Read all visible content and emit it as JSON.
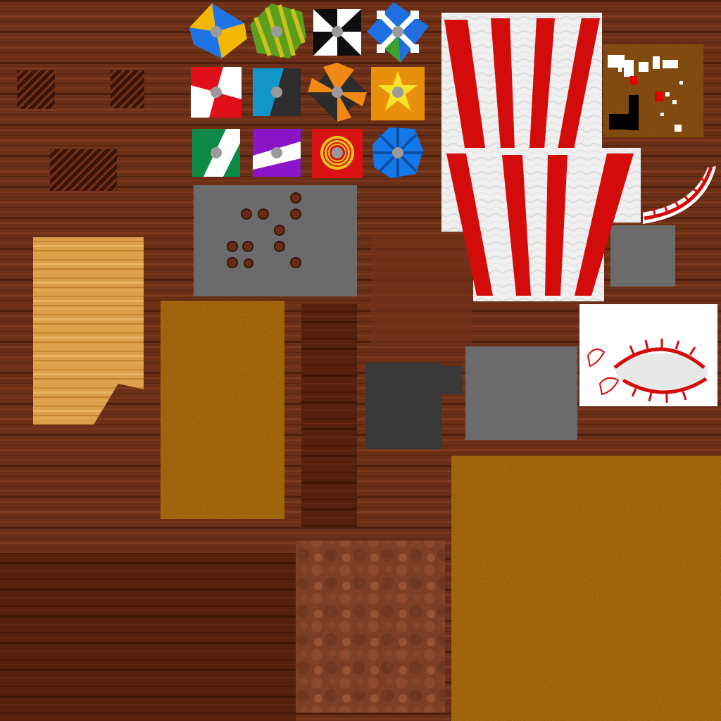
{
  "atlas": {
    "kind": "texture atlas",
    "background": "wood planks",
    "colors": {
      "wood_base": "#6b2e17",
      "wood_dark": "#4e1f0e",
      "wood_light": "#82391c",
      "light_wood": "#dca04a",
      "felt_orange": "#c07a0f",
      "felt_orange_dark": "#a66408",
      "gray": "#6b6b6b",
      "charcoal": "#383838",
      "popcorn_red": "#d30b0b",
      "popcorn_white": "#f2f2f2",
      "carpet_brown": "#7e3a22",
      "weave_dark": "#3b1409",
      "map_brown": "#9c5a12"
    }
  },
  "shields": [
    {
      "name": "yellow-blue-quartered-shield",
      "colors": [
        "#f2b705",
        "#1d74e5"
      ],
      "pattern": "quartered"
    },
    {
      "name": "green-yellow-striped-shield",
      "colors": [
        "#5c9d1f",
        "#c9c21a"
      ],
      "pattern": "striped"
    },
    {
      "name": "black-white-gyronny-shield",
      "colors": [
        "#0e0e0e",
        "#ffffff"
      ],
      "pattern": "gyronny"
    },
    {
      "name": "blue-green-cross-shield",
      "colors": [
        "#1f6fe0",
        "#3aa02e",
        "#ffffff"
      ],
      "pattern": "cross"
    },
    {
      "name": "red-white-quartered-shield",
      "colors": [
        "#e0101b",
        "#ffffff"
      ],
      "pattern": "quartered"
    },
    {
      "name": "blue-black-split-shield",
      "colors": [
        "#1295c8",
        "#2d2d2d"
      ],
      "pattern": "split"
    },
    {
      "name": "orange-black-quartered-shield",
      "colors": [
        "#f08a14",
        "#2c2c2c"
      ],
      "pattern": "quartered"
    },
    {
      "name": "yellow-sun-shield",
      "colors": [
        "#e8900a",
        "#f6e22a"
      ],
      "pattern": "sun"
    },
    {
      "name": "green-white-bend-shield",
      "colors": [
        "#0c8a45",
        "#ffffff"
      ],
      "pattern": "bend"
    },
    {
      "name": "purple-white-bend-shield",
      "colors": [
        "#8a14c8",
        "#ffffff"
      ],
      "pattern": "fess"
    },
    {
      "name": "red-yellow-rings-shield",
      "colors": [
        "#d81212",
        "#f2c21b"
      ],
      "pattern": "rings"
    },
    {
      "name": "blue-spoked-shield",
      "colors": [
        "#1478e8",
        "#0b4fa8"
      ],
      "pattern": "spokes"
    }
  ]
}
